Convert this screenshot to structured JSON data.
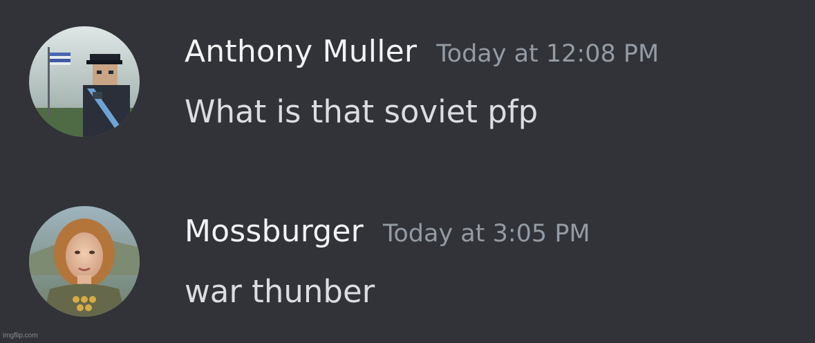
{
  "colors": {
    "background": "#313338",
    "username": "#f2f3f5",
    "timestamp": "#949ba4",
    "message_text": "#dbdee1"
  },
  "messages": [
    {
      "username": "Anthony Muller",
      "timestamp": "Today at 12:08 PM",
      "content": "What is that soviet pfp",
      "avatar_icon": "blocky-character-with-flag-avatar"
    },
    {
      "username": "Mossburger",
      "timestamp": "Today at 3:05 PM",
      "content": "war thunber",
      "avatar_icon": "soldier-woman-portrait-avatar"
    }
  ],
  "watermark": "imgflip.com"
}
